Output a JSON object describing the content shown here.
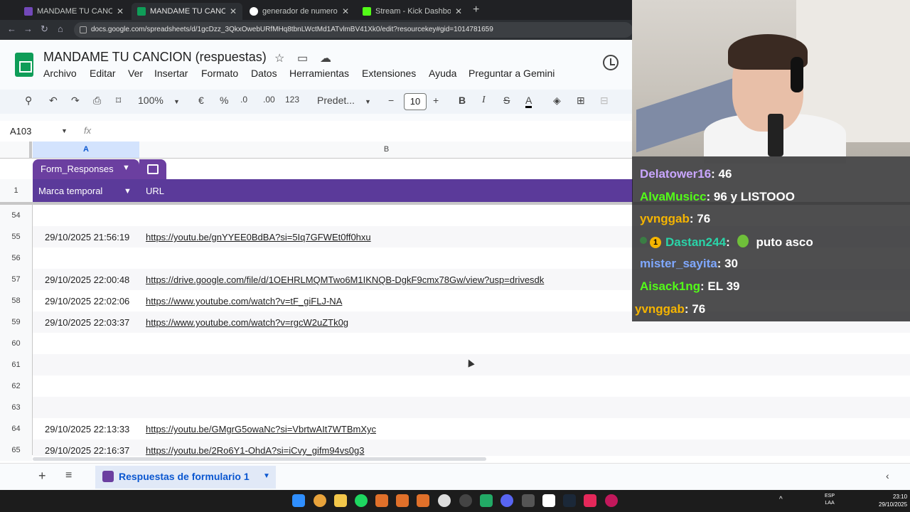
{
  "browser": {
    "tabs": [
      {
        "title": "MANDAME TU CANCION - Fo",
        "icon": "forms-icon",
        "color": "#7248b9",
        "active": false
      },
      {
        "title": "MANDAME TU CANCION (resp",
        "icon": "sheets-icon",
        "color": "#0f9d58",
        "active": true
      },
      {
        "title": "generador de numeros aleatori",
        "icon": "google-icon",
        "color": "#ffffff",
        "active": false
      },
      {
        "title": "Stream - Kick Dashboard",
        "icon": "kick-icon",
        "color": "#53fc18",
        "active": false
      }
    ],
    "new_tab": "+",
    "url": "docs.google.com/spreadsheets/d/1gcDzz_3QkxOwebURfMHq8tbnLWctMd1ATvlmBV41Xk0/edit?resourcekey#gid=1014781659"
  },
  "sheets": {
    "title": "MANDAME TU CANCION (respuestas)",
    "menu": [
      "Archivo",
      "Editar",
      "Ver",
      "Insertar",
      "Formato",
      "Datos",
      "Herramientas",
      "Extensiones",
      "Ayuda",
      "Preguntar a Gemini"
    ],
    "toolbar": {
      "zoom": "100%",
      "currency": "€",
      "percent": "%",
      "dec_decrease": ".0",
      "dec_increase": ".00",
      "number_format": "123",
      "font": "Predet...",
      "font_size": "10",
      "bold": "B",
      "italic": "I",
      "strike": "S",
      "text_color": "A"
    },
    "name_box": "A103",
    "fx": "fx",
    "columns": {
      "a": "A",
      "b": "B"
    },
    "table_name": "Form_Responses",
    "header_row_number": "1",
    "headers": {
      "a": "Marca temporal",
      "b": "URL"
    },
    "rows": [
      {
        "num": "54",
        "a": "",
        "b": ""
      },
      {
        "num": "55",
        "a": "29/10/2025 21:56:19",
        "b": "https://youtu.be/gnYYEE0BdBA?si=5Iq7GFWEt0ff0hxu"
      },
      {
        "num": "56",
        "a": "",
        "b": ""
      },
      {
        "num": "57",
        "a": "29/10/2025 22:00:48",
        "b": "https://drive.google.com/file/d/1OEHRLMQMTwo6M1IKNQB-DgkF9cmx78Gw/view?usp=drivesdk"
      },
      {
        "num": "58",
        "a": "29/10/2025 22:02:06",
        "b": "https://www.youtube.com/watch?v=tF_giFLJ-NA"
      },
      {
        "num": "59",
        "a": "29/10/2025 22:03:37",
        "b": "https://www.youtube.com/watch?v=rgcW2uZTk0g"
      },
      {
        "num": "60",
        "a": "",
        "b": ""
      },
      {
        "num": "61",
        "a": "",
        "b": ""
      },
      {
        "num": "62",
        "a": "",
        "b": ""
      },
      {
        "num": "63",
        "a": "",
        "b": ""
      },
      {
        "num": "64",
        "a": "29/10/2025 22:13:33",
        "b": "https://youtu.be/GMgrG5owaNc?si=VbrtwAIt7WTBmXyc"
      },
      {
        "num": "65",
        "a": "29/10/2025 22:16:37",
        "b": "https://youtu.be/2Ro6Y1-OhdA?si=iCvy_gifm94vs0g3"
      }
    ],
    "sheet_tab": "Respuestas de formulario 1",
    "add_sheet": "+",
    "all_sheets": "≡"
  },
  "chat": [
    {
      "user": "Delatower16",
      "color": "#c9a6ff",
      "msg": ": 46"
    },
    {
      "user": "AlvaMusicc",
      "color": "#53fc18",
      "msg": ": 96 y LISTOOO"
    },
    {
      "user": "yvnggab",
      "color": "#f5b400",
      "msg": ": 76"
    },
    {
      "user": "Dastan244",
      "color": "#2ad4a8",
      "msg": ": ",
      "extra": "puto asco"
    },
    {
      "user": "mister_sayita",
      "color": "#7fa8ff",
      "msg": ": 30"
    },
    {
      "user": "Aisack1ng",
      "color": "#53fc18",
      "msg": ": EL 39"
    },
    {
      "user": "yvnggab",
      "color": "#f5b400",
      "msg": ": 76"
    }
  ],
  "badge_text": "1",
  "taskbar": {
    "lang_top": "ESP",
    "lang_bottom": "LAA",
    "time": "23:10",
    "date": "29/10/2025"
  }
}
